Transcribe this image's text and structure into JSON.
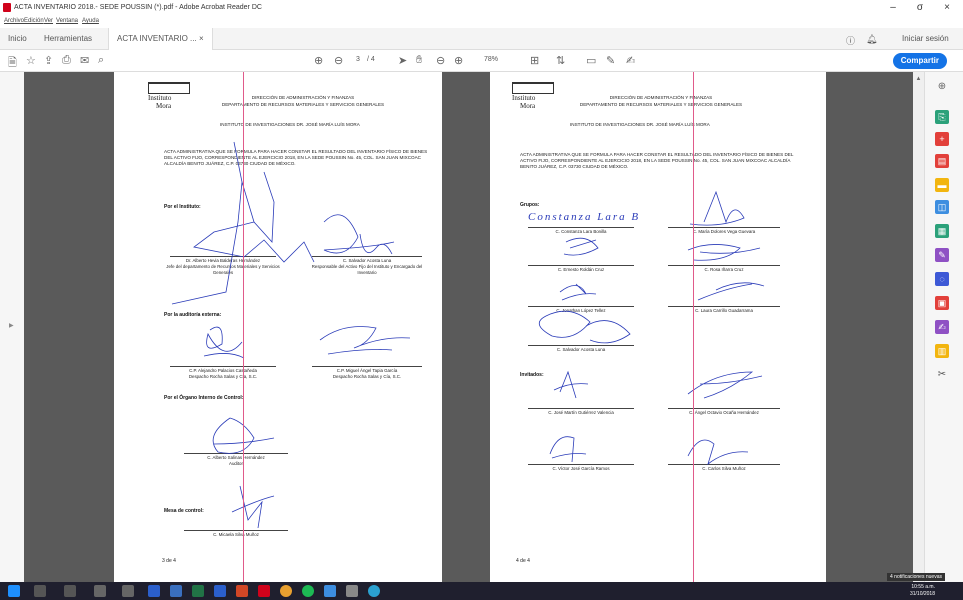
{
  "window": {
    "title": "ACTA INVENTARIO 2018.- SEDE POUSSIN (*).pdf - Adobe Acrobat Reader DC",
    "controls": [
      "–",
      "σ",
      "×"
    ]
  },
  "menu": [
    "Archivo",
    "Edición",
    "Ver",
    "Ventana",
    "Ayuda"
  ],
  "tabs": {
    "home": "Inicio",
    "tools": "Herramientas",
    "doc": "ACTA INVENTARIO ... ×",
    "signin": "Iniciar sesión"
  },
  "toolbar": {
    "page_current": "3",
    "page_total": "/ 4",
    "zoom": "78%",
    "share_label": "Compartir"
  },
  "page3": {
    "logo_name1": "Instituto",
    "logo_name2": "Mora",
    "hdr1": "DIRECCIÓN DE ADMINISTRACIÓN Y FINANZAS",
    "hdr2": "DEPARTAMENTO DE RECURSOS MATERIALES Y SERVICIOS GENERALES",
    "inst": "INSTITUTO DE INVESTIGACIONES DR. JOSÉ MARÍA LUÍS MORA",
    "para": "ACTA ADMINISTRATIVA QUE SE FORMULA PARA HACER CONSTAR EL RESULTADO DEL INVENTARIO FÍSICO DE BIENES DEL ACTIVO FIJO, CORRESPONDIENTE AL EJERCICIO 2018, EN LA SEDE POUSSIN No. 45, COL. SAN JUAN MIXCOAC ALCALDÍA BENITO JUÁREZ, C.P. 03730 CIUDAD DE MÉXICO.",
    "sec_instituto": "Por el Instituto:",
    "sig1": "Dr. Alberto Hevia Balderas Hernández",
    "sig1b": "Jefe del departamento de Recursos Materiales y Servicios Generales",
    "sig2": "C. Salvador Acosta Luna",
    "sig2b": "Responsable del Activo Fijo del Instituto y Encargado del Inventario",
    "sec_auditoria": "Por la auditoría externa:",
    "sig3": "C.P. Alejandro Palacios Castañeda",
    "sig3b": "Despacho Rocha Salas y Cía, S.C.",
    "sig4": "C.P. Miguel Ángel Tapia García",
    "sig4b": "Despacho Rocha Salas y Cía, S.C.",
    "sec_organo": "Por el Órgano Interno de Control:",
    "sig5": "C. Alberto Salinas Hernández",
    "sig5b": "Auditor",
    "sec_mesa": "Mesa de control:",
    "sig6": "C. Micaela Silva Muñoz",
    "page_num": "3 de 4"
  },
  "page4": {
    "logo_name1": "Instituto",
    "logo_name2": "Mora",
    "hdr1": "DIRECCIÓN DE ADMINISTRACIÓN Y FINANZAS",
    "hdr2": "DEPARTAMENTO DE RECURSOS MATERIALES Y SERVICIOS GENERALES",
    "inst": "INSTITUTO DE INVESTIGACIONES DR. JOSÉ MARÍA LUÍS MORA",
    "para": "ACTA ADMINISTRATIVA QUE SE FORMULA PARA HACER CONSTAR EL RESULTADO DEL INVENTARIO FÍSICO DE BIENES DEL ACTIVO FIJO, CORRESPONDIENTE AL EJERCICIO 2018, EN LA SEDE POUSSIN No. 45, COL. SAN JUAN MIXCOAC ALCALDÍA BENITO JUÁREZ, C.P. 03730 CIUDAD DE MÉXICO.",
    "sec_grupos": "Grupos:",
    "handwritten": "Constanza Lara B",
    "g1": "C. Constanza Lara Bonilla",
    "g2": "C. María Dolores Vega Guevara",
    "g3": "C. Ernesto Roldán Cruz",
    "g4": "C. Rosa Iñarra Cruz",
    "g5": "C. Jonathan López Tellez",
    "g6": "C. Laura Carrillo Guadarrama",
    "g7": "C. Salvador Acosta Luna",
    "sec_invitados": "Invitados:",
    "i1": "C. José Martín Gutiérrez Valencia",
    "i2": "C. Ángel Octavio Ocaña Hernández",
    "i3": "C. Víctor José García Ramos",
    "i4": "C. Carlos Silva Muñoz",
    "page_num": "4 de 4"
  },
  "taskbar": {
    "time": "10:55 a.m.",
    "date": "31/10/2018",
    "notifications": "4 notificaciones nuevas"
  },
  "colors": {
    "accent": "#1473e6",
    "ink": "#2a3bb8",
    "marker": "#e05a8a"
  }
}
